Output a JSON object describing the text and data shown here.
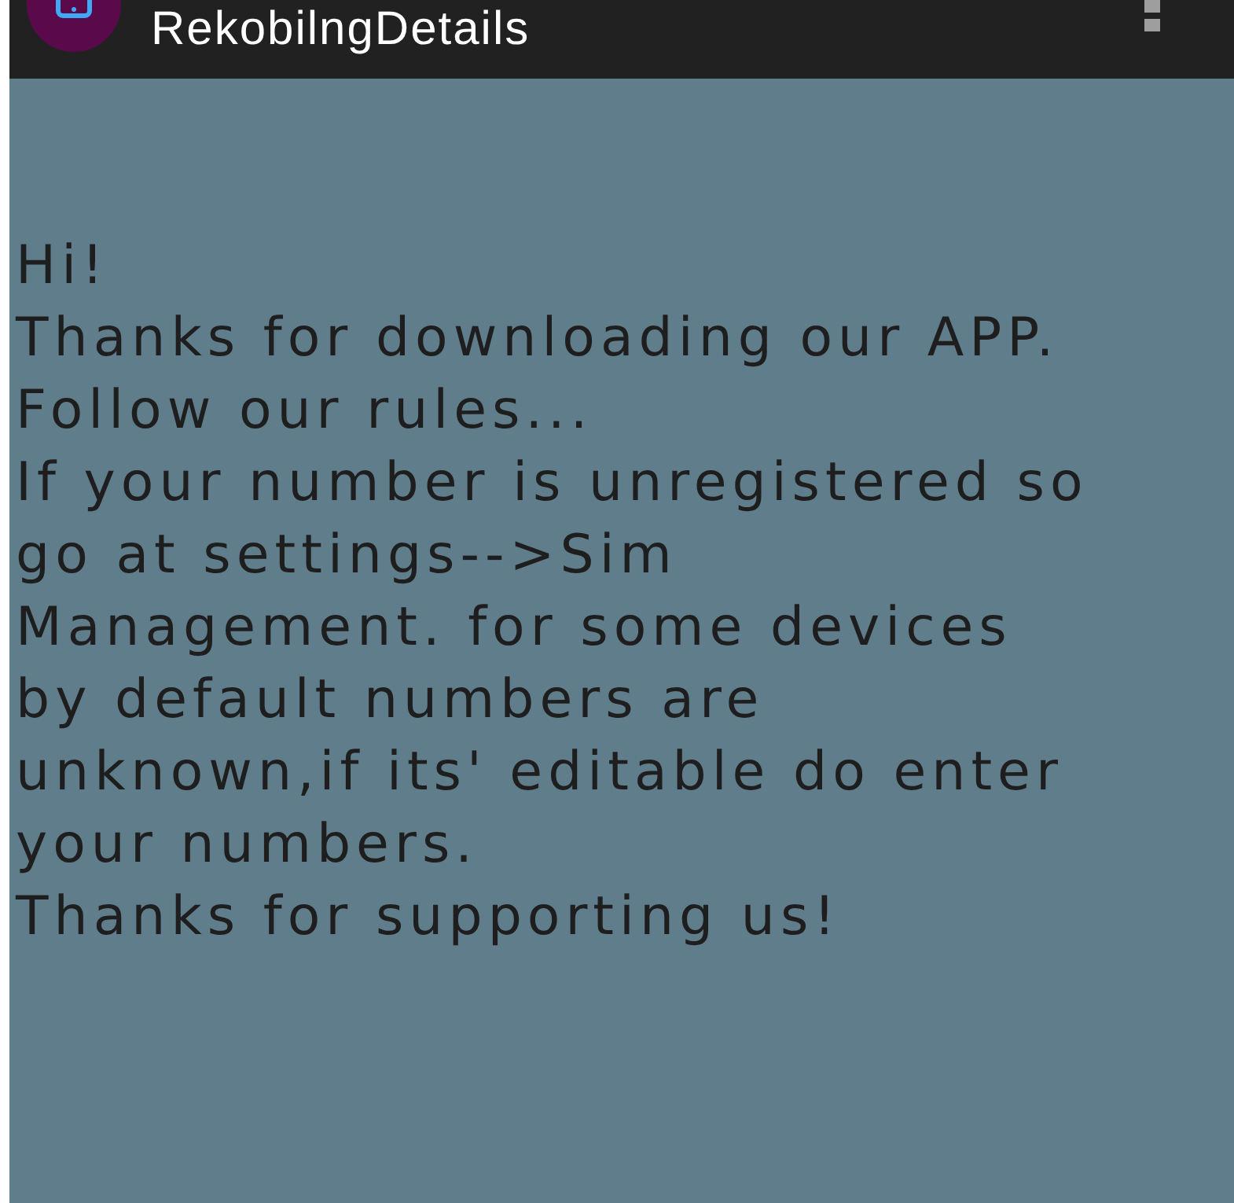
{
  "app_bar": {
    "title": "RekobilngDetails"
  },
  "message_lines": [
    "Hi!",
    "Thanks for downloading our APP.",
    "Follow our rules...",
    "If your number is unregistered so",
    "go at settings-->Sim",
    "Management. for some devices",
    "by default numbers are",
    "unknown,if its' editable do enter",
    "your numbers.",
    "Thanks for supporting us!"
  ]
}
